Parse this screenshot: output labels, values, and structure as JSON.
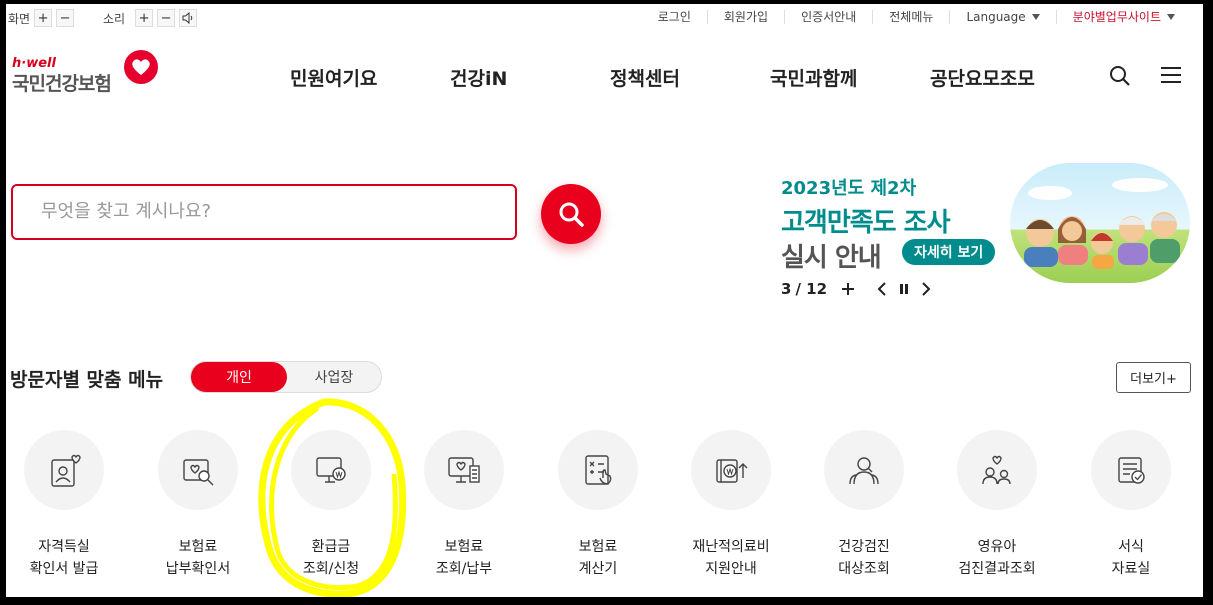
{
  "utility": {
    "screen_label": "화면",
    "sound_label": "소리",
    "plus": "+",
    "minus": "−",
    "links": [
      "로그인",
      "회원가입",
      "인증서안내",
      "전체메뉴"
    ],
    "language": "Language",
    "field_site": "분야별업무사이트"
  },
  "logo": {
    "tagline": "h·well",
    "name": "국민건강보험"
  },
  "nav": [
    "민원여기요",
    "건강iN",
    "정책센터",
    "국민과함께",
    "공단요모조모"
  ],
  "search": {
    "placeholder": "무엇을 찾고 계시나요?"
  },
  "banner": {
    "line1": "2023년도 제2차",
    "line2": "고객만족도 조사",
    "line3": "실시 안내",
    "button": "자세히 보기",
    "page_current": "3",
    "page_total": "/ 12"
  },
  "visitor_menu": {
    "title": "방문자별 맞춤 메뉴",
    "tab_personal": "개인",
    "tab_business": "사업장",
    "more": "더보기+",
    "items": [
      {
        "line1": "자격득실",
        "line2": "확인서 발급",
        "icon": "person-card-icon"
      },
      {
        "line1": "보험료",
        "line2": "납부확인서",
        "icon": "document-search-icon"
      },
      {
        "line1": "환급금",
        "line2": "조회/신청",
        "icon": "monitor-won-icon"
      },
      {
        "line1": "보험료",
        "line2": "조회/납부",
        "icon": "monitor-receipt-icon"
      },
      {
        "line1": "보험료",
        "line2": "계산기",
        "icon": "calculator-icon"
      },
      {
        "line1": "재난적의료비",
        "line2": "지원안내",
        "icon": "won-arrow-icon"
      },
      {
        "line1": "건강검진",
        "line2": "대상조회",
        "icon": "people-search-icon"
      },
      {
        "line1": "영유아",
        "line2": "검진결과조회",
        "icon": "family-heart-icon"
      },
      {
        "line1": "서식",
        "line2": "자료실",
        "icon": "form-check-icon"
      }
    ]
  },
  "colors": {
    "brand_red": "#e8001c",
    "teal": "#008c8c",
    "highlight": "#ffff00"
  }
}
